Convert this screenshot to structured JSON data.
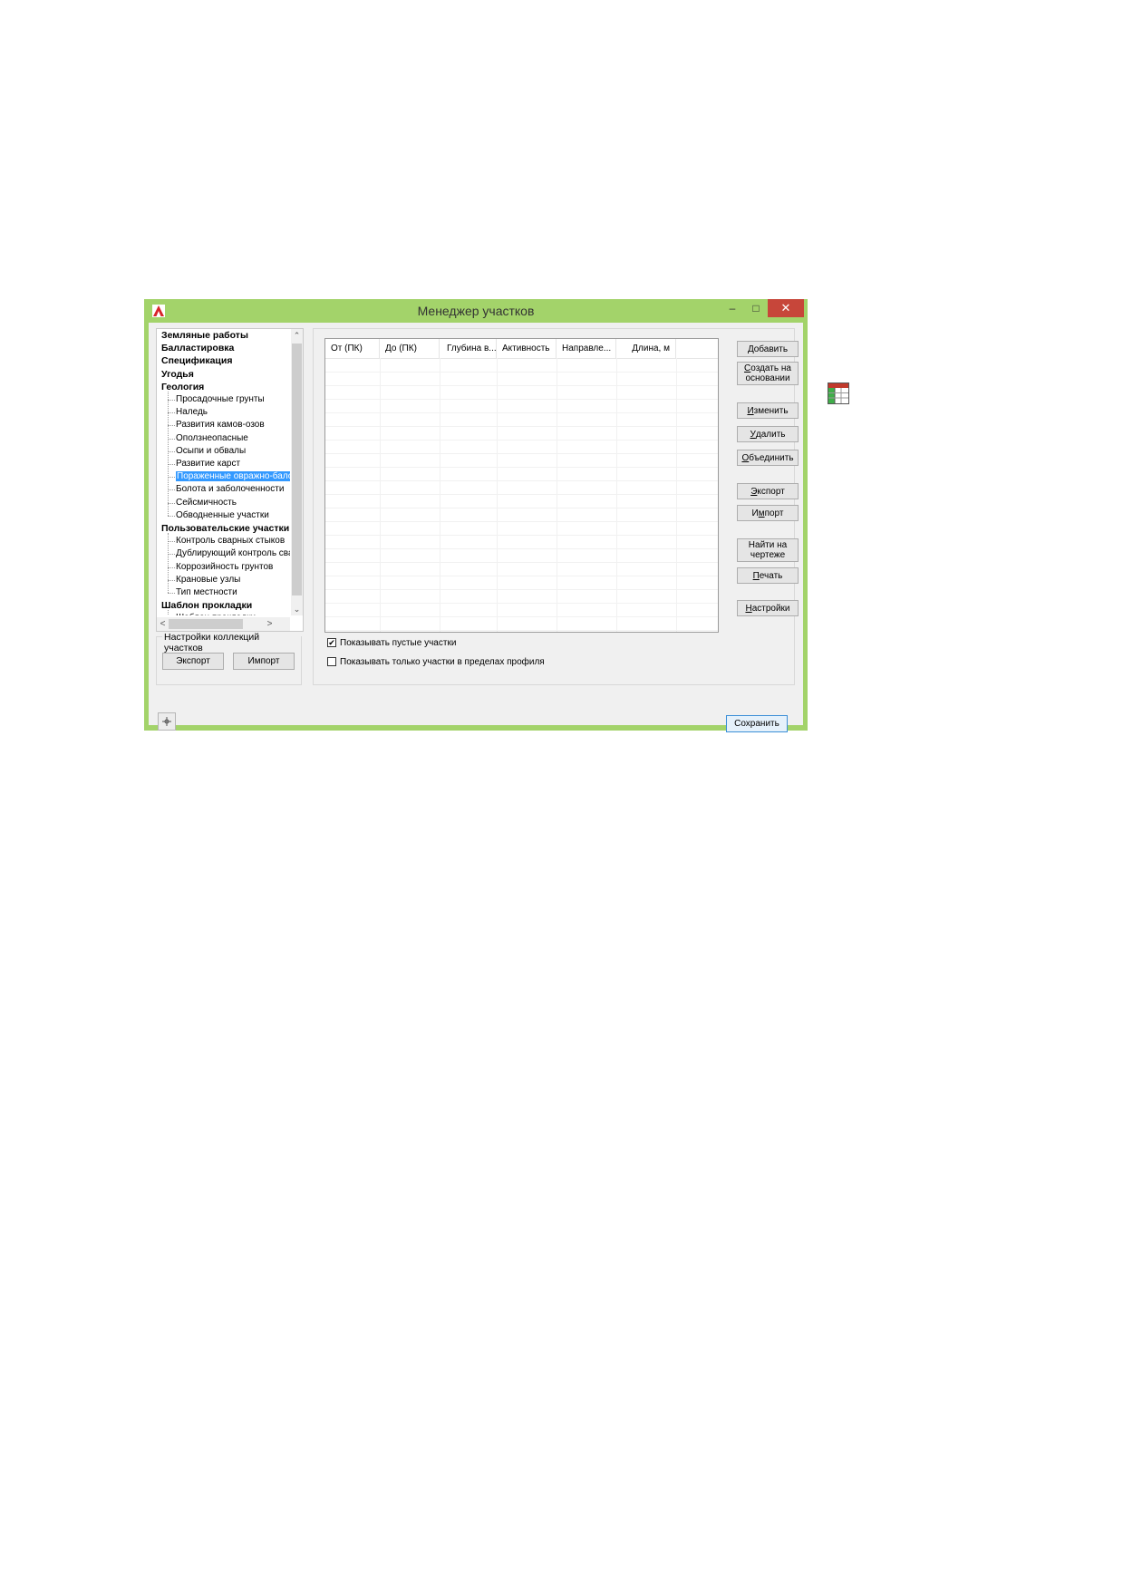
{
  "window": {
    "title": "Менеджер участков",
    "minimize_glyph": "–",
    "maximize_glyph": "□",
    "close_glyph": "✕"
  },
  "tree": {
    "items": [
      {
        "label": "Земляные работы",
        "level": 0
      },
      {
        "label": "Балластировка",
        "level": 0
      },
      {
        "label": "Спецификация",
        "level": 0
      },
      {
        "label": "Угодья",
        "level": 0
      },
      {
        "label": "Геология",
        "level": 0
      },
      {
        "label": "Просадочные грунты",
        "level": 1
      },
      {
        "label": "Наледь",
        "level": 1
      },
      {
        "label": "Развития камов-озов",
        "level": 1
      },
      {
        "label": "Оползнеопасные",
        "level": 1
      },
      {
        "label": "Осыпи и обвалы",
        "level": 1
      },
      {
        "label": "Развитие карст",
        "level": 1
      },
      {
        "label": "Пораженные овражно-балочными",
        "level": 1,
        "selected": true
      },
      {
        "label": "Болота и заболоченности",
        "level": 1
      },
      {
        "label": "Сейсмичность",
        "level": 1
      },
      {
        "label": "Обводненные участки",
        "level": 1
      },
      {
        "label": "Пользовательские участки",
        "level": 0
      },
      {
        "label": "Контроль сварных стыков",
        "level": 1
      },
      {
        "label": "Дублирующий контроль сварных стыков",
        "level": 1
      },
      {
        "label": "Коррозийность грунтов",
        "level": 1
      },
      {
        "label": "Крановые узлы",
        "level": 1
      },
      {
        "label": "Тип местности",
        "level": 1
      },
      {
        "label": "Шаблон прокладки",
        "level": 0
      },
      {
        "label": "Шаблон прокладки",
        "level": 1
      }
    ],
    "scroll_up": "⌃",
    "scroll_down": "⌄",
    "scroll_left": "<",
    "scroll_right": ">"
  },
  "collections": {
    "group_label": "Настройки коллекций участков",
    "export_label": "Экспорт",
    "import_label": "Импорт"
  },
  "table": {
    "columns": [
      "От (ПК)",
      "До (ПК)",
      "Глубина в...",
      "Активность",
      "Направле...",
      "Длина, м"
    ]
  },
  "actions": {
    "add": {
      "pre": "",
      "u": "Д",
      "post": "обавить"
    },
    "create_based_1": {
      "pre": "",
      "u": "С",
      "post": "оздать на"
    },
    "create_based_2": "основании",
    "edit": {
      "pre": "",
      "u": "И",
      "post": "зменить"
    },
    "delete": {
      "pre": "",
      "u": "У",
      "post": "далить"
    },
    "merge": {
      "pre": "",
      "u": "О",
      "post": "бъединить"
    },
    "export": {
      "pre": "",
      "u": "Э",
      "post": "кспорт"
    },
    "import": {
      "pre": "И",
      "u": "м",
      "post": "порт"
    },
    "find_1": "Найти на",
    "find_2": "чертеже",
    "print": {
      "pre": "",
      "u": "П",
      "post": "ечать"
    },
    "settings": {
      "pre": "",
      "u": "Н",
      "post": "астройки"
    }
  },
  "options": {
    "show_empty": {
      "label": "Показывать пустые участки",
      "checked": true,
      "mark": "✔"
    },
    "show_in_profile": {
      "label": "Показывать только участки в пределах профиля",
      "checked": false
    }
  },
  "footer": {
    "save_label": "Сохранить",
    "pin_icon": "pin-icon"
  },
  "colors": {
    "window_frame": "#a3d36a",
    "close_button": "#c7463a",
    "selection": "#3399ff"
  }
}
